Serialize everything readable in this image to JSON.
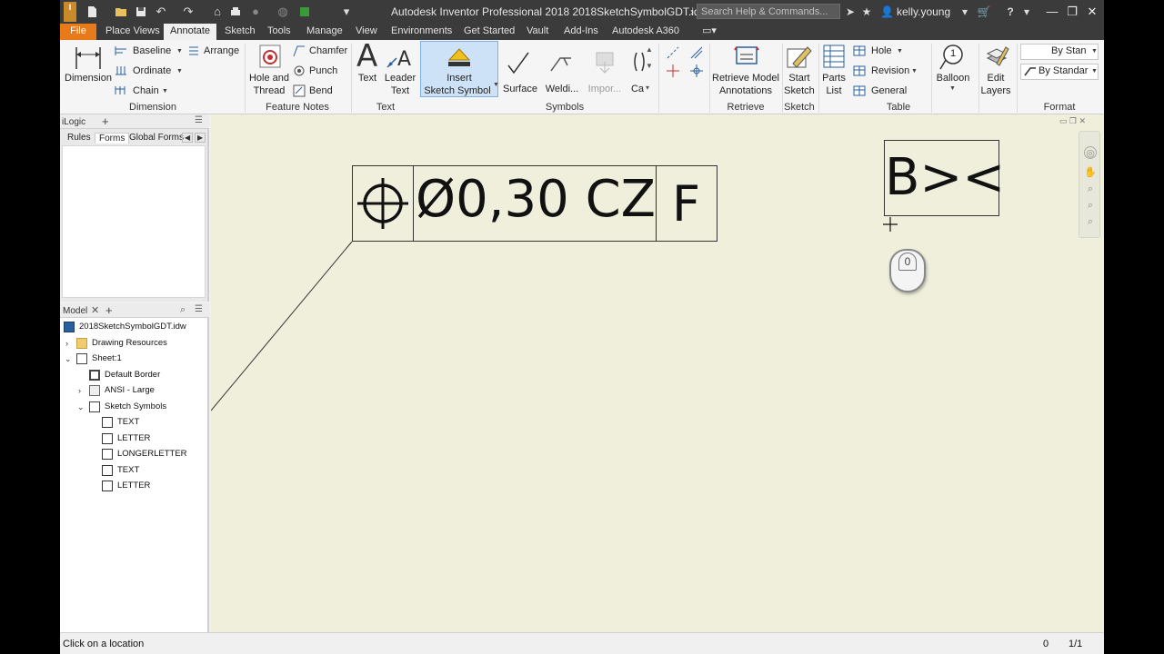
{
  "titlebar": {
    "app_logo": "I",
    "title": "Autodesk Inventor Professional 2018    2018SketchSymbolGDT.idw",
    "search_placeholder": "Search Help & Commands...",
    "user": "kelly.young"
  },
  "tabs": [
    {
      "label": "File"
    },
    {
      "label": "Place Views"
    },
    {
      "label": "Annotate"
    },
    {
      "label": "Sketch"
    },
    {
      "label": "Tools"
    },
    {
      "label": "Manage"
    },
    {
      "label": "View"
    },
    {
      "label": "Environments"
    },
    {
      "label": "Get Started"
    },
    {
      "label": "Vault"
    },
    {
      "label": "Add-Ins"
    },
    {
      "label": "Autodesk A360"
    }
  ],
  "ribbon": {
    "dimension": {
      "main": "Dimension",
      "baseline": "Baseline",
      "ordinate": "Ordinate",
      "chain": "Chain",
      "arrange": "Arrange",
      "panel": "Dimension"
    },
    "feature_notes": {
      "hole_thread_1": "Hole and",
      "hole_thread_2": "Thread",
      "chamfer": "Chamfer",
      "punch": "Punch",
      "bend": "Bend",
      "panel": "Feature Notes"
    },
    "text": {
      "text": "Text",
      "leader_1": "Leader",
      "leader_2": "Text",
      "panel": "Text"
    },
    "symbols": {
      "insert_1": "Insert",
      "insert_2": "Sketch Symbol",
      "surface": "Surface",
      "welding": "Weldi...",
      "import": "Impor...",
      "ca": "Ca",
      "panel": "Symbols"
    },
    "retrieve": {
      "btn_1": "Retrieve Model",
      "btn_2": "Annotations",
      "panel": "Retrieve"
    },
    "sketch": {
      "btn_1": "Start",
      "btn_2": "Sketch",
      "panel": "Sketch"
    },
    "table": {
      "parts_1": "Parts",
      "parts_2": "List",
      "hole": "Hole",
      "revision": "Revision",
      "general": "General",
      "panel": "Table"
    },
    "balloon": {
      "label": "Balloon",
      "number": "1"
    },
    "layers": {
      "btn_1": "Edit",
      "btn_2": "Layers"
    },
    "format": {
      "style1": "By Stan",
      "style2": "By Standar",
      "panel": "Format"
    }
  },
  "ilogic": {
    "title": "iLogic",
    "tabs": [
      "Rules",
      "Forms",
      "Global Forms"
    ]
  },
  "model": {
    "title": "Model",
    "tree": [
      {
        "label": "2018SketchSymbolGDT.idw"
      },
      {
        "label": "Drawing Resources"
      },
      {
        "label": "Sheet:1"
      },
      {
        "label": "Default Border"
      },
      {
        "label": "ANSI - Large"
      },
      {
        "label": "Sketch Symbols"
      },
      {
        "label": "TEXT"
      },
      {
        "label": "LETTER"
      },
      {
        "label": "LONGERLETTER"
      },
      {
        "label": "TEXT"
      },
      {
        "label": "LETTER"
      }
    ]
  },
  "canvas": {
    "fcf": {
      "tolerance": "Ø0,30 CZ",
      "datum": "F"
    },
    "symbol_box": "B><",
    "mouse_button": "0"
  },
  "status": {
    "text": "Click on a location",
    "count": "0",
    "page": "1/1"
  },
  "colors": {
    "file_tab": "#e97a1a",
    "canvas_bg": "#efefdc",
    "titlebar": "#3b3b3b",
    "highlight": "#cde2f6"
  }
}
